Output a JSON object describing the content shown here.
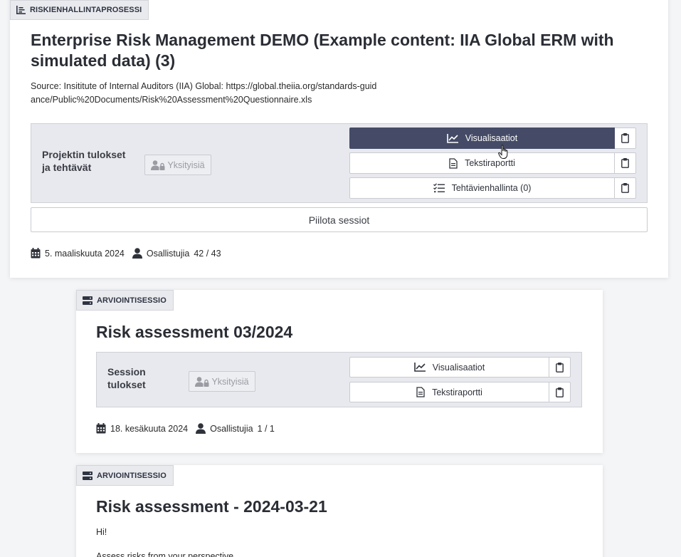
{
  "process_card": {
    "tag": "RISKIENHALLINTAPROSESSI",
    "title": "Enterprise Risk Management DEMO (Example content: IIA Global ERM with simulated data) (3)",
    "source": "Source: Insititute of Internal Auditors (IIA) Global: https://global.theiia.org/standards-guidance/Public%20Documents/Risk%20Assessment%20Questionnaire.xls",
    "panel_label": "Projektin tulokset ja tehtävät",
    "private_label": "Yksityisiä",
    "actions": [
      {
        "label": "Visualisaatiot",
        "icon": "line-chart-icon",
        "active": true
      },
      {
        "label": "Tekstiraportti",
        "icon": "document-icon",
        "active": false
      },
      {
        "label": "Tehtävienhallinta (0)",
        "icon": "checklist-icon",
        "active": false
      }
    ],
    "hide_sessions_label": "Piilota sessiot",
    "date": "5. maaliskuuta 2024",
    "participants_label": "Osallistujia",
    "participants_count": "42 / 43"
  },
  "session_card_1": {
    "tag": "ARVIOINTISESSIO",
    "title": "Risk assessment 03/2024",
    "panel_label": "Session tulokset",
    "private_label": "Yksityisiä",
    "actions": [
      {
        "label": "Visualisaatiot",
        "icon": "line-chart-icon"
      },
      {
        "label": "Tekstiraportti",
        "icon": "document-icon"
      }
    ],
    "date": "18. kesäkuuta 2024",
    "participants_label": "Osallistujia",
    "participants_count": "1 / 1"
  },
  "session_card_2": {
    "tag": "ARVIOINTISESSIO",
    "title": "Risk assessment - 2024-03-21",
    "greeting": "Hi!",
    "description": "Assess risks from your perspective"
  },
  "colors": {
    "active_button": "#454b66",
    "panel_bg": "#e8e9ee",
    "tag_bg": "#e9eaee",
    "page_bg": "#f4f5f7"
  }
}
